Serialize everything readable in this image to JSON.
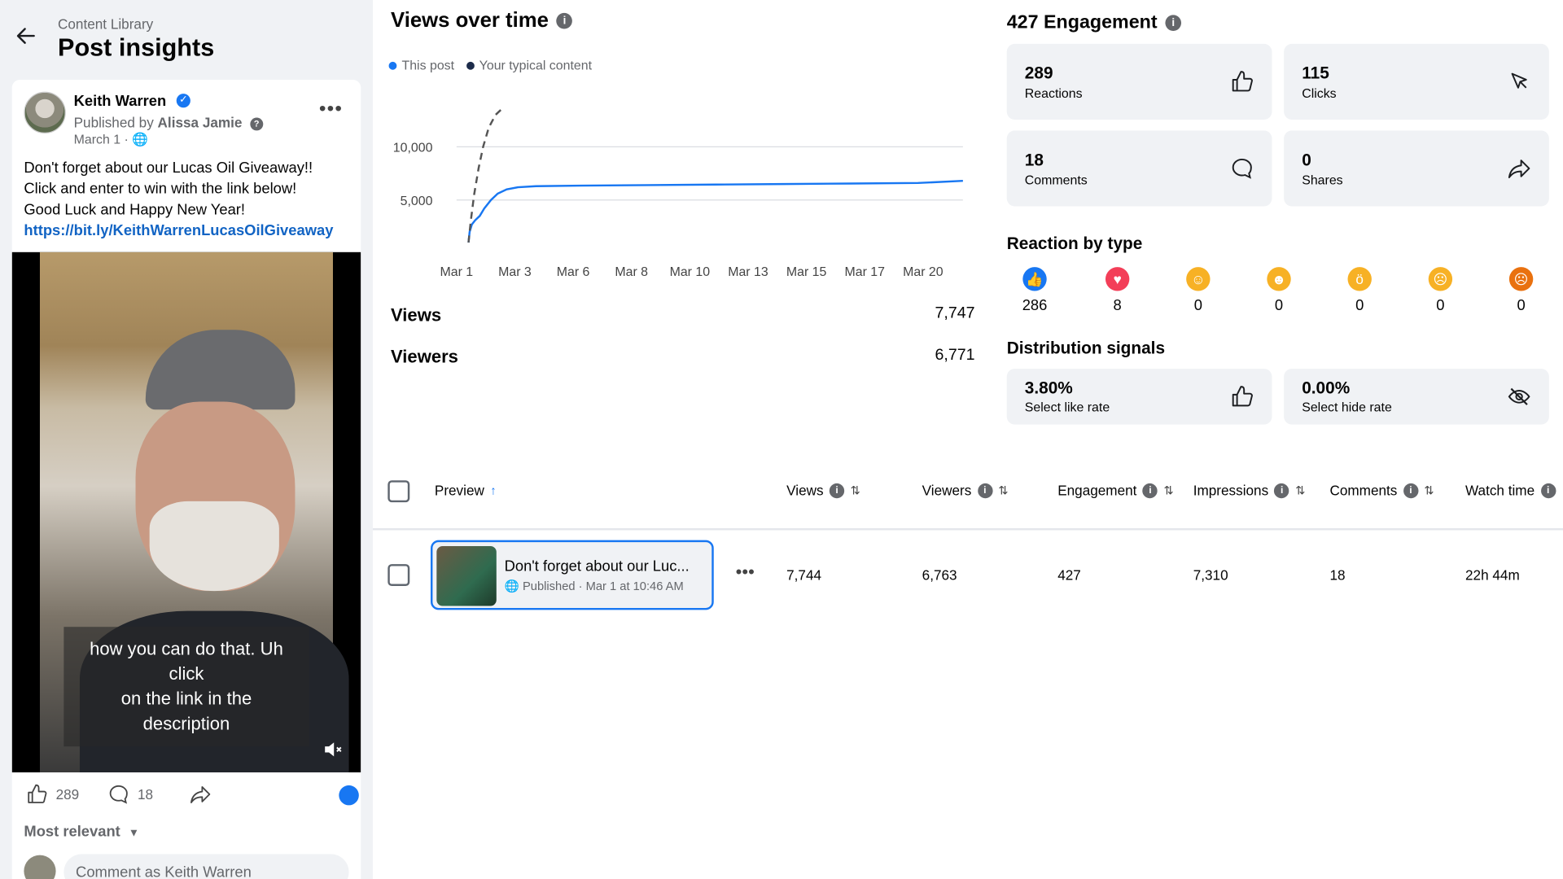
{
  "header": {
    "breadcrumb": "Content Library",
    "title": "Post insights"
  },
  "post": {
    "author": "Keith Warren",
    "published_by_prefix": "Published by",
    "publisher": "Alissa Jamie",
    "date": "March 1 ·",
    "text_lines": [
      "Don't forget about our Lucas Oil Giveaway!!",
      "Click and enter to win with the link below!",
      "Good Luck and Happy New Year!"
    ],
    "link": "https://bit.ly/KeithWarrenLucasOilGiveaway",
    "caption_lines": [
      "how you can do that. Uh",
      "click",
      "on the link in the",
      "description"
    ],
    "likes": "289",
    "comments": "18",
    "sort_label": "Most relevant",
    "comment_placeholder": "Comment as Keith Warren"
  },
  "views_panel": {
    "title": "Views over time",
    "legend": [
      {
        "name": "This post",
        "color": "#1877f2"
      },
      {
        "name": "Your typical content",
        "color": "#1c2b4a"
      }
    ],
    "views_label": "Views",
    "views_value": "7,747",
    "viewers_label": "Viewers",
    "viewers_value": "6,771"
  },
  "chart_data": {
    "type": "line",
    "title": "Views over time",
    "x_tick_labels": [
      "Mar 1",
      "Mar 3",
      "Mar 6",
      "Mar 8",
      "Mar 10",
      "Mar 13",
      "Mar 15",
      "Mar 17",
      "Mar 20"
    ],
    "y_tick_labels": [
      "10,000",
      "5,000"
    ],
    "y_ticks": [
      10000,
      5000
    ],
    "ylim": [
      0,
      15000
    ],
    "series": [
      {
        "name": "This post",
        "color": "#1877f2",
        "style": "solid",
        "points": [
          [
            0,
            1000
          ],
          [
            0.05,
            2000
          ],
          [
            0.15,
            2700
          ],
          [
            0.3,
            3100
          ],
          [
            0.5,
            3500
          ],
          [
            0.7,
            4200
          ],
          [
            1.0,
            5000
          ],
          [
            1.3,
            5600
          ],
          [
            1.7,
            6000
          ],
          [
            2.2,
            6200
          ],
          [
            3,
            6300
          ],
          [
            5,
            6350
          ],
          [
            8,
            6400
          ],
          [
            11,
            6450
          ],
          [
            14,
            6500
          ],
          [
            17,
            6550
          ],
          [
            20,
            6600
          ],
          [
            22,
            6800
          ]
        ]
      },
      {
        "name": "Your typical content",
        "color": "#555555",
        "style": "dashed",
        "points": [
          [
            0,
            1000
          ],
          [
            0.1,
            3000
          ],
          [
            0.25,
            5500
          ],
          [
            0.45,
            8000
          ],
          [
            0.65,
            10000
          ],
          [
            0.9,
            11800
          ],
          [
            1.2,
            13000
          ],
          [
            1.5,
            13600
          ]
        ]
      }
    ],
    "grid": true
  },
  "engagement": {
    "title": "427 Engagement",
    "cards": [
      {
        "value": "289",
        "label": "Reactions",
        "icon": "thumbs-up-icon"
      },
      {
        "value": "115",
        "label": "Clicks",
        "icon": "cursor-icon"
      },
      {
        "value": "18",
        "label": "Comments",
        "icon": "comment-icon"
      },
      {
        "value": "0",
        "label": "Shares",
        "icon": "share-icon"
      }
    ],
    "reaction_title": "Reaction by type",
    "reactions": [
      {
        "name": "like",
        "count": "286",
        "color": "#1877f2",
        "glyph": "👍"
      },
      {
        "name": "love",
        "count": "8",
        "color": "#f33e58",
        "glyph": "♥"
      },
      {
        "name": "care",
        "count": "0",
        "color": "#f7b125",
        "glyph": "☺"
      },
      {
        "name": "haha",
        "count": "0",
        "color": "#f7b125",
        "glyph": "☻"
      },
      {
        "name": "wow",
        "count": "0",
        "color": "#f7b125",
        "glyph": "ö"
      },
      {
        "name": "sad",
        "count": "0",
        "color": "#f7b125",
        "glyph": "☹"
      },
      {
        "name": "angry",
        "count": "0",
        "color": "#e9710f",
        "glyph": "☹"
      }
    ],
    "distribution_title": "Distribution signals",
    "signals": [
      {
        "value": "3.80%",
        "label": "Select like rate",
        "icon": "thumbs-up-icon"
      },
      {
        "value": "0.00%",
        "label": "Select hide rate",
        "icon": "eye-off-icon"
      }
    ]
  },
  "table": {
    "headers": {
      "preview": "Preview",
      "views": "Views",
      "viewers": "Viewers",
      "engagement": "Engagement",
      "impressions": "Impressions",
      "comments": "Comments",
      "watch_time": "Watch time"
    },
    "row": {
      "title": "Don't forget about our Luc...",
      "status": "Published",
      "date": "· Mar 1 at 10:46 AM",
      "views": "7,744",
      "viewers": "6,763",
      "engagement": "427",
      "impressions": "7,310",
      "comments": "18",
      "watch_time": "22h 44m"
    }
  }
}
